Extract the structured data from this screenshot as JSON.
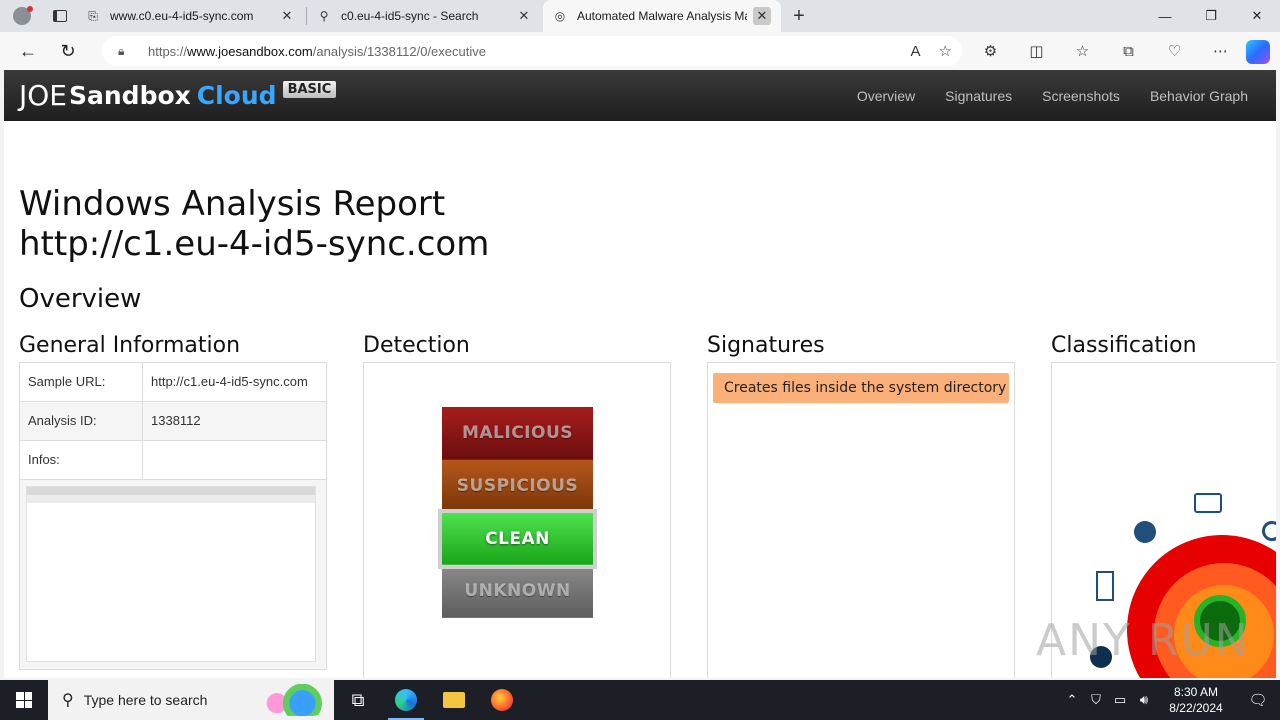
{
  "browser": {
    "tabs": [
      {
        "title": "www.c0.eu-4-id5-sync.com",
        "icon": "page-icon",
        "active": false
      },
      {
        "title": "c0.eu-4-id5-sync - Search",
        "icon": "search-icon",
        "active": false
      },
      {
        "title": "Automated Malware Analysis Ma",
        "icon": "joesandbox-icon",
        "active": true
      }
    ],
    "url_prefix": "https://",
    "url_domain": "www.joesandbox.com",
    "url_path": "/analysis/1338112/0/executive"
  },
  "site": {
    "logo": {
      "joe": "JOE",
      "sandbox": "Sandbox",
      "cloud": "Cloud",
      "badge": "BASIC"
    },
    "nav": [
      "Overview",
      "Signatures",
      "Screenshots",
      "Behavior Graph"
    ]
  },
  "report": {
    "title_line1": "Windows Analysis Report",
    "title_line2": "http://c1.eu-4-id5-sync.com",
    "overview_heading": "Overview",
    "sections": {
      "general": "General Information",
      "detection": "Detection",
      "signatures": "Signatures",
      "classification": "Classification"
    },
    "general_info": [
      {
        "key": "Sample URL:",
        "value": "http://c1.eu-4-id5-sync.com"
      },
      {
        "key": "Analysis ID:",
        "value": "1338112"
      },
      {
        "key": "Infos:",
        "value": ""
      }
    ],
    "detection_levels": [
      "MALICIOUS",
      "SUSPICIOUS",
      "CLEAN",
      "UNKNOWN"
    ],
    "detection_selected": "CLEAN",
    "signatures_list": [
      "Creates files inside the system directory"
    ]
  },
  "watermark": "ANY RUN",
  "taskbar": {
    "search_placeholder": "Type here to search",
    "time": "8:30 AM",
    "date": "8/22/2024"
  }
}
